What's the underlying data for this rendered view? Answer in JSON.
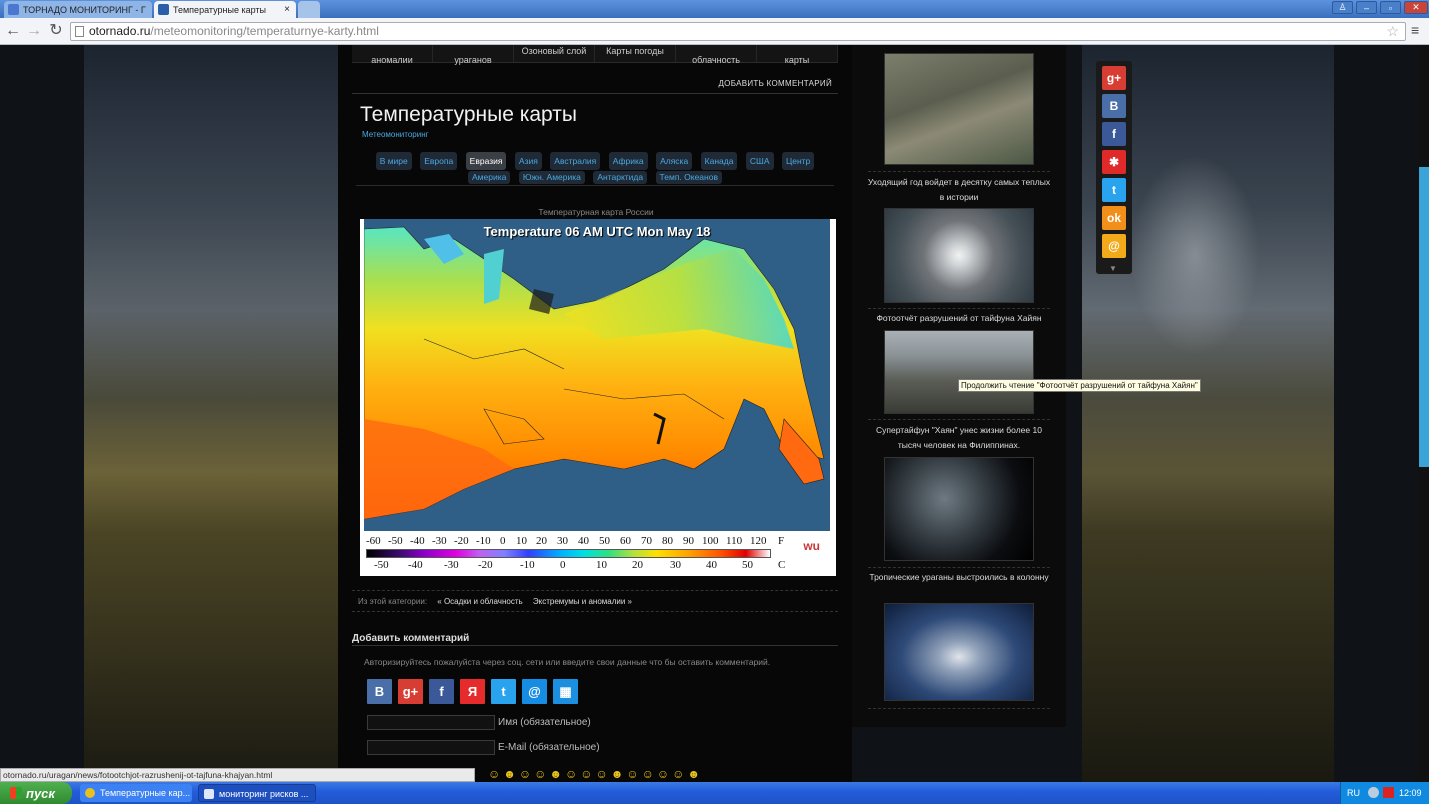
{
  "browser": {
    "tabs": [
      {
        "label": "ТОРНАДО МОНИТОРИНГ - Г"
      },
      {
        "label": "Температурные карты"
      }
    ],
    "url_host": "otornado.ru",
    "url_path": "/meteomonitoring/temperaturnye-karty.html",
    "status_url": "otornado.ru/uragan/news/fotootchjot-razrushenij-ot-tajfuna-khajyan.html"
  },
  "page": {
    "top_nav": [
      "аномалии",
      "ураганов",
      "Озоновый слой",
      "Карты погоды",
      "облачность",
      "карты"
    ],
    "add_comment_link": "ДОБАВИТЬ КОММЕНТАРИЙ",
    "title": "Температурные карты",
    "subtitle": "Метеомониторинг",
    "categories_row1": [
      "В мире",
      "Европа",
      "Евразия",
      "Азия",
      "Австралия",
      "Африка",
      "Аляска",
      "Канада",
      "США",
      "Центр"
    ],
    "categories_row2": [
      "Америка",
      "Южн. Америка",
      "Антарктида",
      "Темп. Океанов"
    ],
    "active_category": "Евразия",
    "map_caption": "Температурная карта России",
    "map_title": "Temperature 06 AM UTC Mon May 18",
    "scale_f": [
      "-60",
      "-50",
      "-40",
      "-30",
      "-20",
      "-10",
      "0",
      "10",
      "20",
      "30",
      "40",
      "50",
      "60",
      "70",
      "80",
      "90",
      "100",
      "110",
      "120",
      "F"
    ],
    "scale_c": [
      "-50",
      "-40",
      "-30",
      "-20",
      "-10",
      "0",
      "10",
      "20",
      "30",
      "40",
      "50",
      "C"
    ],
    "wu_logo": "wu",
    "from_category_label": "Из этой категории:",
    "prev_link": "« Осадки и облачность",
    "next_link": "Экстремумы и аномалии »",
    "comment_heading": "Добавить комментарий",
    "auth_text": "Авторизируйтесь пожалуйста через соц. сети или введите свои данные что бы оставить комментарий.",
    "social_login": [
      {
        "icon": "vkontakte-icon",
        "glyph": "B",
        "color": "#4a6ea8"
      },
      {
        "icon": "google-plus-icon",
        "glyph": "g+",
        "color": "#d73d32"
      },
      {
        "icon": "facebook-icon",
        "glyph": "f",
        "color": "#3b5998"
      },
      {
        "icon": "yandex-icon",
        "glyph": "Я",
        "color": "#e52b2b"
      },
      {
        "icon": "twitter-icon",
        "glyph": "t",
        "color": "#2aa3ef"
      },
      {
        "icon": "mailru-icon",
        "glyph": "@",
        "color": "#168de2"
      },
      {
        "icon": "windows-live-icon",
        "glyph": "▦",
        "color": "#1d8fe0"
      }
    ],
    "name_label": "Имя (обязательное)",
    "email_label": "E-Mail (обязательное)"
  },
  "sidebar": {
    "items": [
      {
        "title": "Уходящий год войдет в десятку самых теплых в истории"
      },
      {
        "title": "Фотоотчёт разрушений от тайфуна Хайян"
      },
      {
        "title": "Супертайфун \"Хаян\" унес жизни более 10 тысяч человек на Филиппинах."
      },
      {
        "title": "Тропические ураганы выстроились в колонну"
      }
    ],
    "tooltip": "Продолжить чтение \"Фотоотчёт разрушений от тайфуна Хайян\""
  },
  "share_bar": [
    {
      "icon": "google-plus-icon",
      "glyph": "g+",
      "color": "#d73d32"
    },
    {
      "icon": "vkontakte-icon",
      "glyph": "B",
      "color": "#4a6ea8"
    },
    {
      "icon": "facebook-icon",
      "glyph": "f",
      "color": "#3b5998"
    },
    {
      "icon": "moimir-icon",
      "glyph": "✱",
      "color": "#e02a2a"
    },
    {
      "icon": "twitter-icon",
      "glyph": "t",
      "color": "#2aa3ef"
    },
    {
      "icon": "odnoklassniki-icon",
      "glyph": "ok",
      "color": "#f28f1a"
    },
    {
      "icon": "mailru-icon",
      "glyph": "@",
      "color": "#f2a91a"
    }
  ],
  "taskbar": {
    "start_label": "пуск",
    "tasks": [
      {
        "label": "Температурные кар..."
      },
      {
        "label": "мониторинг рисков ..."
      }
    ],
    "lang": "RU",
    "clock": "12:09"
  }
}
